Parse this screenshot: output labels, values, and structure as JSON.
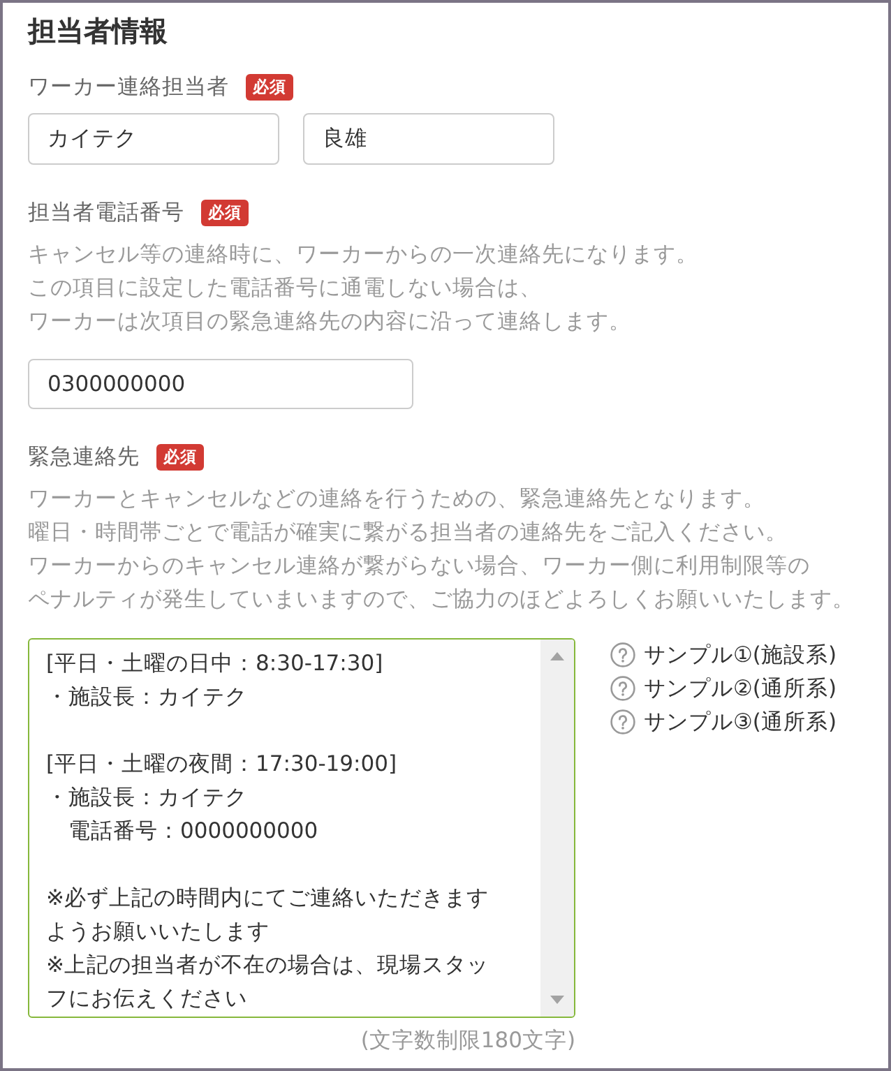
{
  "section_title": "担当者情報",
  "fields": [
    {
      "kind": "name",
      "label": "ワーカー連絡担当者",
      "badge": "必須",
      "inputs": [
        {
          "value": "カイテク"
        },
        {
          "value": "良雄"
        }
      ]
    },
    {
      "kind": "phone",
      "label": "担当者電話番号",
      "badge": "必須",
      "description": [
        "キャンセル等の連絡時に、ワーカーからの一次連絡先になります。",
        "この項目に設定した電話番号に通電しない場合は、",
        "ワーカーは次項目の緊急連絡先の内容に沿って連絡します。"
      ],
      "input": {
        "value": "0300000000"
      }
    },
    {
      "kind": "emergency",
      "label": "緊急連絡先",
      "badge": "必須",
      "description": [
        "ワーカーとキャンセルなどの連絡を行うための、緊急連絡先となります。",
        "曜日・時間帯ごとで電話が確実に繋がる担当者の連絡先をご記入ください。",
        "ワーカーからのキャンセル連絡が繋がらない場合、ワーカー側に利用制限等の",
        "ペナルティが発生していまいますので、ご協力のほどよろしくお願いいたします。"
      ],
      "textarea": {
        "paragraphs": [
          [
            "[平日・土曜の日中：8:30-17:30]",
            "・施設長：カイテク"
          ],
          [
            "[平日・土曜の夜間：17:30-19:00]",
            "・施設長：カイテク",
            "　電話番号：0000000000"
          ],
          [
            "※必ず上記の時間内にてご連絡いただきますようお願いいたします",
            "※上記の担当者が不在の場合は、現場スタッフにお伝えください"
          ]
        ],
        "limit_note": "(文字数制限180文字)"
      },
      "sample_links": [
        "サンプル①(施設系)",
        "サンプル②(通所系)",
        "サンプル③(通所系)"
      ]
    }
  ]
}
